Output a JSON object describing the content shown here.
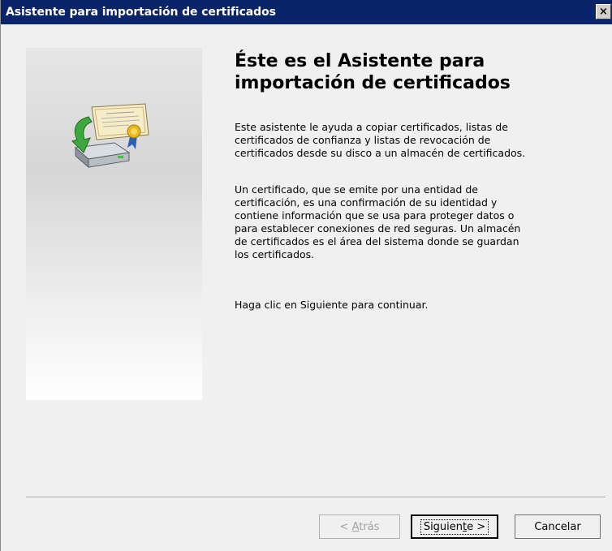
{
  "window": {
    "title": "Asistente para importación de certificados",
    "close_label": "×"
  },
  "sidebar": {
    "icon": "certificate-import-icon"
  },
  "main": {
    "heading_line1": "Éste es el Asistente para",
    "heading_line2": "importación de certificados",
    "paragraph1": [
      "Este asistente le ayuda a copiar certificados, listas de",
      "certificados de confianza y listas de revocación de",
      "certificados desde su disco a un almacén de certificados."
    ],
    "paragraph2": [
      "Un certificado, que se emite por una entidad de",
      "certificación, es una confirmación de su identidad y",
      "contiene información que se usa para proteger datos o",
      "para establecer conexiones de red seguras. Un almacén",
      "de certificados es el área del sistema donde se guardan",
      "los certificados."
    ],
    "paragraph3": "Haga clic en Siguiente para continuar."
  },
  "buttons": {
    "back_prefix": "< ",
    "back_mnemonic": "A",
    "back_rest": "trás",
    "next_prefix": "Siguien",
    "next_mnemonic": "t",
    "next_rest": "e >",
    "cancel": "Cancelar"
  },
  "colors": {
    "titlebar": "#0a246a",
    "dialog_bg": "#f0f0f0"
  }
}
